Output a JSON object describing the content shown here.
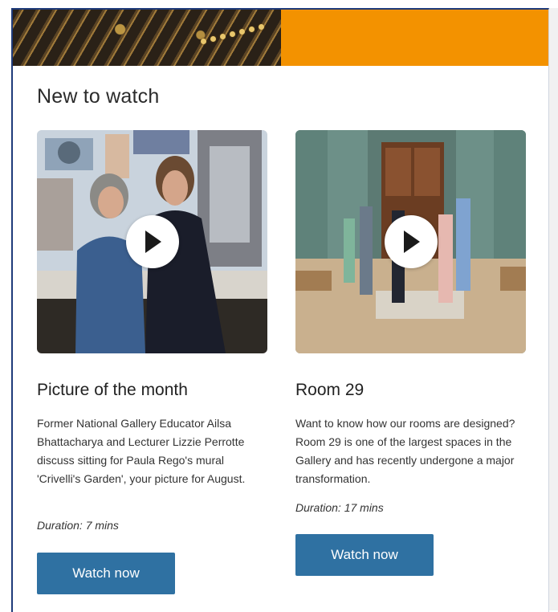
{
  "section": {
    "title": "New to watch"
  },
  "cards": [
    {
      "title": "Picture of the month",
      "description": "Former National Gallery Educator Ailsa Bhattacharya and Lecturer Lizzie Perrotte discuss sitting for Paula Rego's mural 'Crivelli's Garden', your picture for August.",
      "duration": "Duration: 7 mins",
      "button_label": "Watch now"
    },
    {
      "title": "Room 29",
      "description": "Want to know how our rooms are designed? Room 29 is one of the largest spaces in the Gallery and has recently undergone a major transformation.",
      "duration": "Duration: 17 mins",
      "button_label": "Watch now"
    }
  ],
  "colors": {
    "accent_orange": "#f39200",
    "button_blue": "#2f71a2",
    "frame_border": "#1f3b7a"
  },
  "icons": {
    "play": "play-icon"
  }
}
